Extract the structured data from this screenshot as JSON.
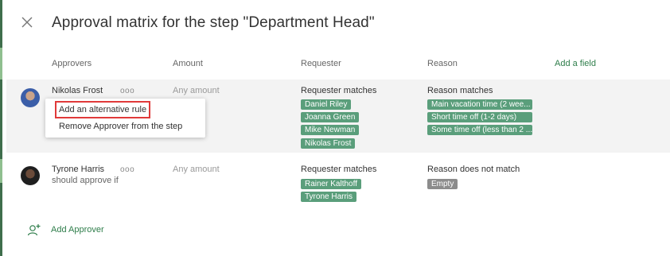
{
  "dialog": {
    "title": "Approval matrix for the step \"Department Head\"",
    "close_icon": "close-icon"
  },
  "columns": {
    "approvers": "Approvers",
    "amount": "Amount",
    "requester": "Requester",
    "reason": "Reason",
    "add_field": "Add a field"
  },
  "rows": [
    {
      "name": "Nikolas Frost",
      "subtitle": "",
      "amount": "Any amount",
      "requester_cond": "Requester matches",
      "requesters": [
        "Daniel Riley",
        "Joanna Green",
        "Mike Newman",
        "Nikolas Frost"
      ],
      "reason_cond": "Reason matches",
      "reasons": [
        "Main vacation time (2 wee...",
        "Short time off (1-2 days)",
        "Some time off (less than 2 ..."
      ]
    },
    {
      "name": "Tyrone Harris",
      "subtitle": "should approve if",
      "amount": "Any amount",
      "requester_cond": "Requester matches",
      "requesters": [
        "Rainer Kalthoff",
        "Tyrone Harris"
      ],
      "reason_cond": "Reason does not match",
      "reasons": [
        "Empty"
      ]
    }
  ],
  "more_glyph": "ooo",
  "context_menu": {
    "items": [
      "Add an alternative rule",
      "Remove Approver from the step"
    ]
  },
  "footer": {
    "add_approver": "Add Approver"
  },
  "colors": {
    "accent": "#2e7d4a",
    "tag_green": "#5a9e7b",
    "tag_gray": "#8c8c8c",
    "highlight_outline": "#e03a3a"
  }
}
